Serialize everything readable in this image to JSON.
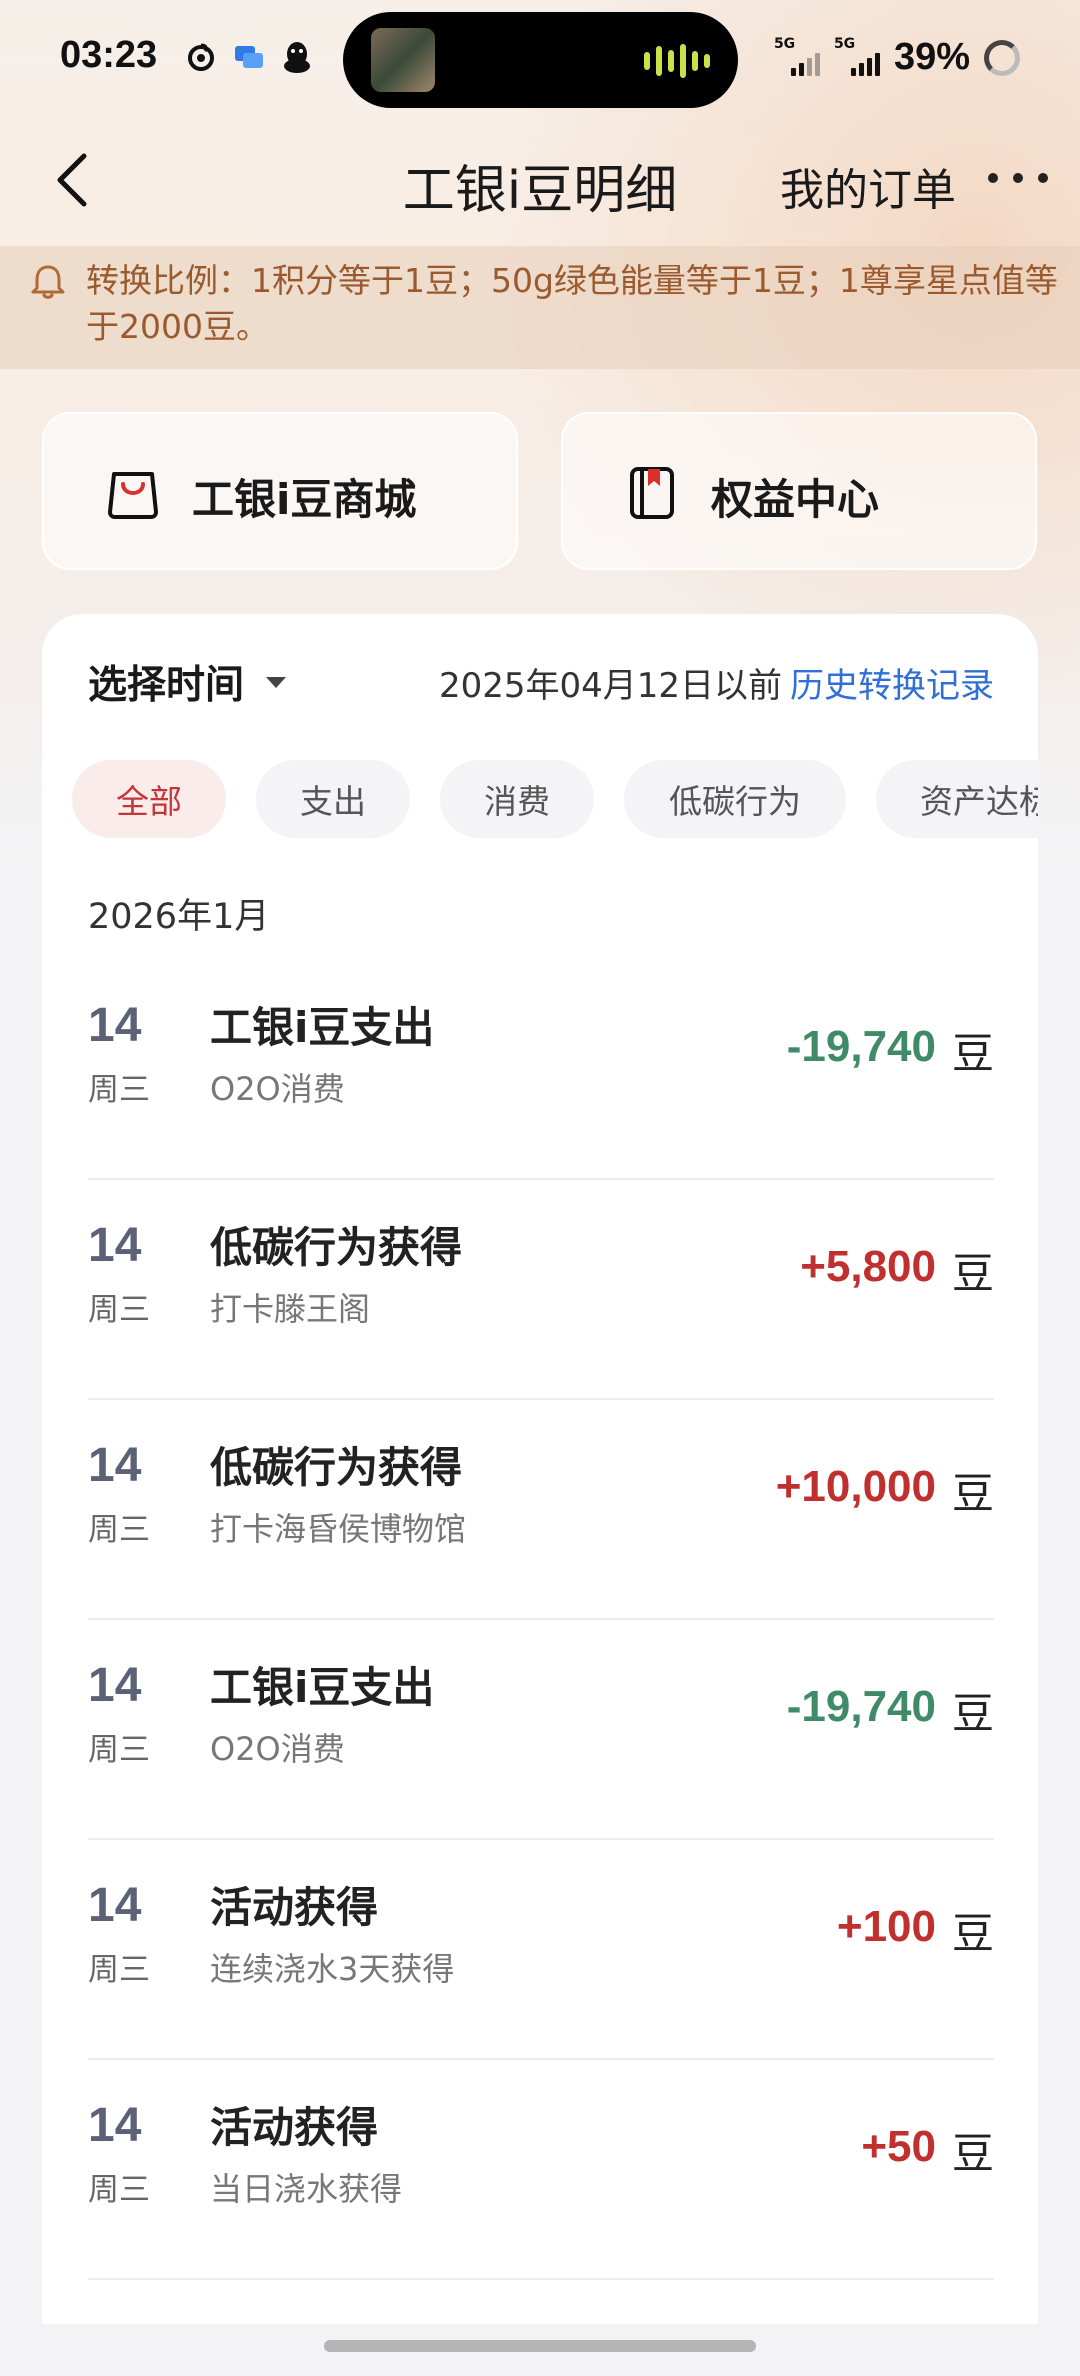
{
  "status_bar": {
    "time": "03:23",
    "battery": "39%",
    "signal1_label": "5G",
    "signal2_label": "5G",
    "left_icons": [
      "netease-music-icon",
      "message-bubble-icon",
      "penguin-icon"
    ]
  },
  "nav": {
    "title": "工银i豆明细",
    "orders": "我的订单"
  },
  "notice": {
    "text": "转换比例：1积分等于1豆；50g绿色能量等于1豆；1尊享星点值等于2000豆。"
  },
  "quick_links": [
    {
      "label": "工银i豆商城"
    },
    {
      "label": "权益中心"
    }
  ],
  "filter": {
    "time_label": "选择时间",
    "date_note": "2025年04月12日以前",
    "history_link": "历史转换记录"
  },
  "tabs": [
    {
      "label": "全部",
      "active": true
    },
    {
      "label": "支出",
      "active": false
    },
    {
      "label": "消费",
      "active": false
    },
    {
      "label": "低碳行为",
      "active": false
    },
    {
      "label": "资产达标",
      "active": false
    }
  ],
  "month": "2026年1月",
  "records": [
    {
      "day": "14",
      "weekday": "周三",
      "title": "工银i豆支出",
      "subtitle": "O2O消费",
      "amount": "-19,740",
      "unit": "豆",
      "type": "neg"
    },
    {
      "day": "14",
      "weekday": "周三",
      "title": "低碳行为获得",
      "subtitle": "打卡滕王阁",
      "amount": "+5,800",
      "unit": "豆",
      "type": "pos"
    },
    {
      "day": "14",
      "weekday": "周三",
      "title": "低碳行为获得",
      "subtitle": "打卡海昏侯博物馆",
      "amount": "+10,000",
      "unit": "豆",
      "type": "pos"
    },
    {
      "day": "14",
      "weekday": "周三",
      "title": "工银i豆支出",
      "subtitle": "O2O消费",
      "amount": "-19,740",
      "unit": "豆",
      "type": "neg"
    },
    {
      "day": "14",
      "weekday": "周三",
      "title": "活动获得",
      "subtitle": "连续浇水3天获得",
      "amount": "+100",
      "unit": "豆",
      "type": "pos"
    },
    {
      "day": "14",
      "weekday": "周三",
      "title": "活动获得",
      "subtitle": "当日浇水获得",
      "amount": "+50",
      "unit": "豆",
      "type": "pos"
    }
  ],
  "colors": {
    "negative": "#3f8a67",
    "positive": "#c0302e",
    "link": "#2f6fd6",
    "notice_text": "#9a5a2e",
    "active_tab": "#c0363a"
  }
}
